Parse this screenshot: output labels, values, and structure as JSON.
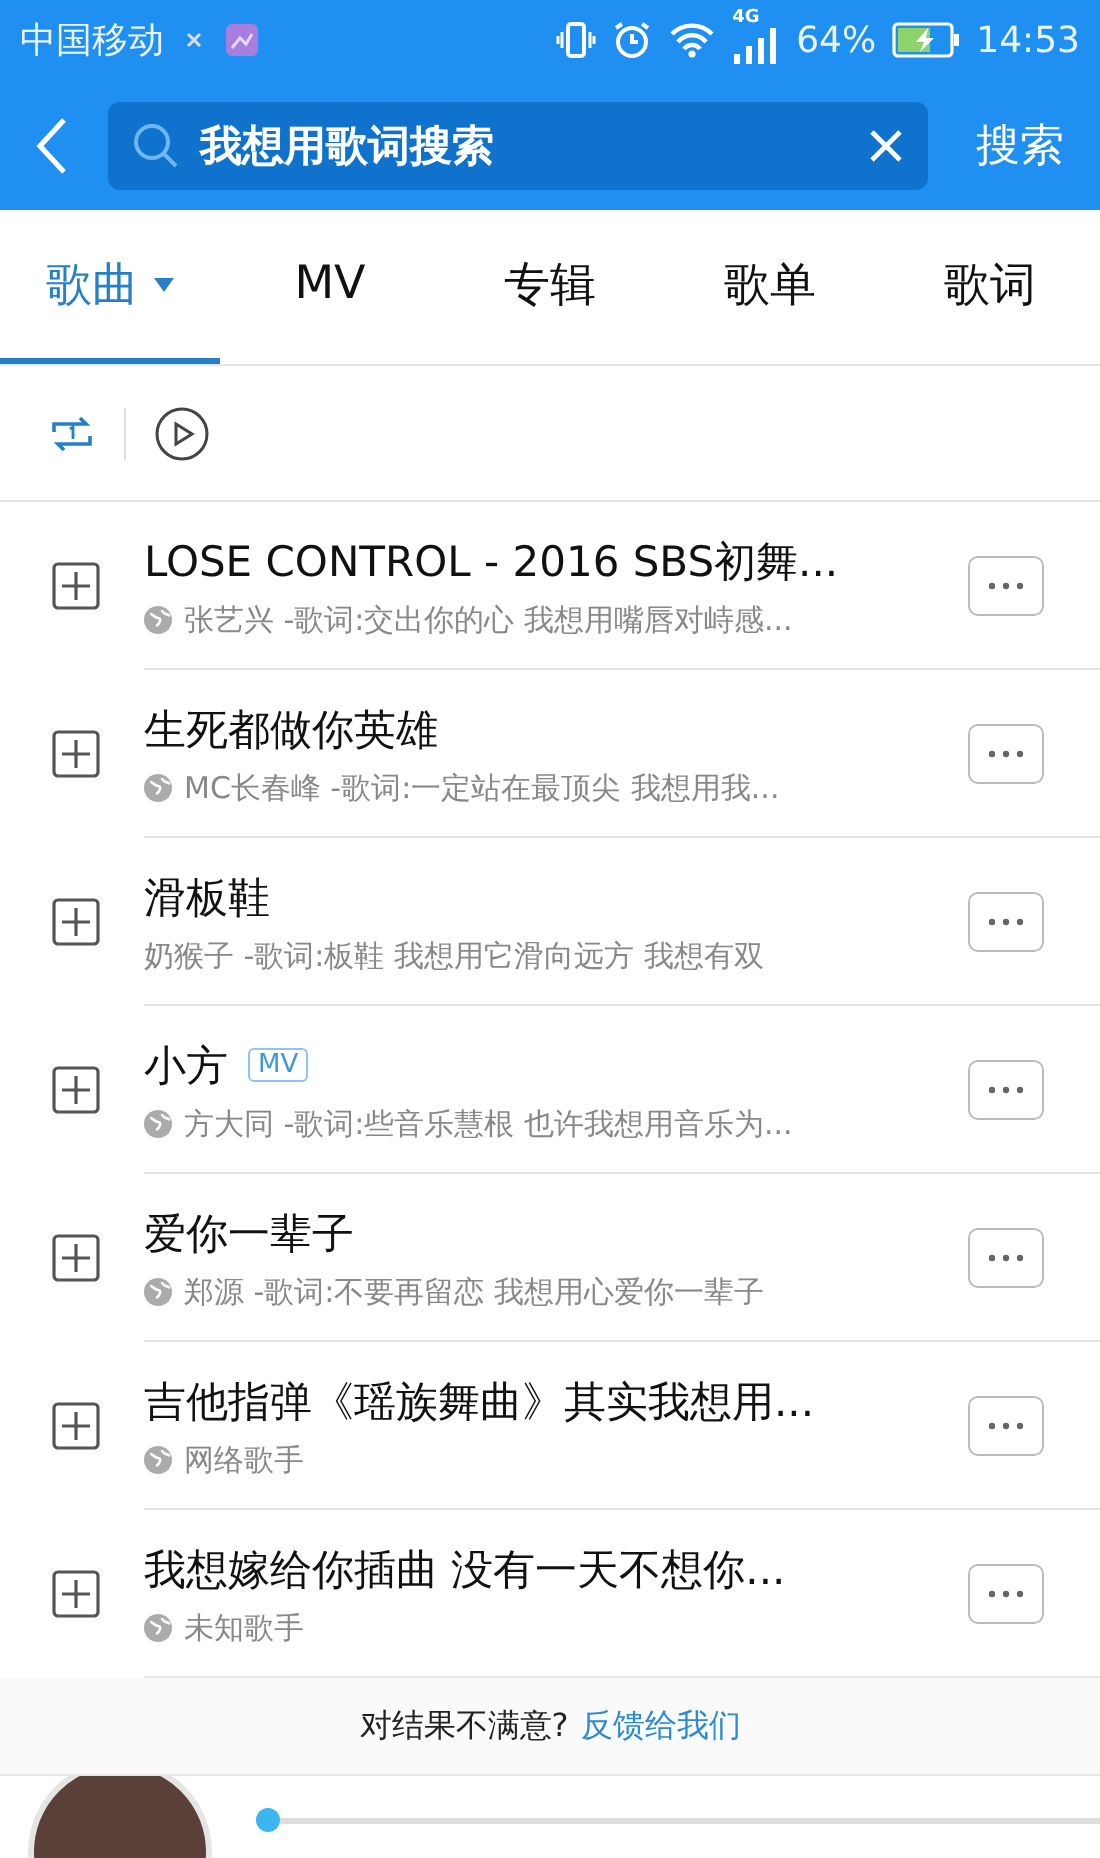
{
  "status_bar": {
    "carrier": "中国移动",
    "network": "4G",
    "battery": "64%",
    "charging": true,
    "time": "14:53"
  },
  "search": {
    "value": "我想用歌词搜索",
    "button": "搜索"
  },
  "tabs": [
    {
      "label": "歌曲",
      "selected": true,
      "dropdown": true
    },
    {
      "label": "MV",
      "selected": false,
      "dropdown": false
    },
    {
      "label": "专辑",
      "selected": false,
      "dropdown": false
    },
    {
      "label": "歌单",
      "selected": false,
      "dropdown": false
    },
    {
      "label": "歌词",
      "selected": false,
      "dropdown": false
    }
  ],
  "songs": [
    {
      "title": "LOSE CONTROL - 2016 SBS初舞...",
      "mv": false,
      "online": true,
      "subtitle": "张艺兴 -歌词:交出你的心 我想用嘴唇对峙感..."
    },
    {
      "title": "生死都做你英雄",
      "mv": false,
      "online": true,
      "subtitle": "MC长春峰 -歌词:一定站在最顶尖 我想用我..."
    },
    {
      "title": "滑板鞋",
      "mv": false,
      "online": false,
      "subtitle": "奶猴子 -歌词:板鞋 我想用它滑向远方 我想有双"
    },
    {
      "title": "小方",
      "mv": true,
      "mv_label": "MV",
      "online": true,
      "subtitle": "方大同 -歌词:些音乐慧根 也许我想用音乐为..."
    },
    {
      "title": "爱你一辈子",
      "mv": false,
      "online": true,
      "subtitle": "郑源 -歌词:不要再留恋 我想用心爱你一辈子"
    },
    {
      "title": "吉他指弹《瑶族舞曲》其实我想用...",
      "mv": false,
      "online": true,
      "subtitle": "网络歌手"
    },
    {
      "title": "我想嫁给你插曲 没有一天不想你...",
      "mv": false,
      "online": true,
      "subtitle": "未知歌手"
    }
  ],
  "feedback": {
    "question": "对结果不满意?",
    "link": "反馈给我们"
  },
  "player": {
    "level": 0.0
  }
}
